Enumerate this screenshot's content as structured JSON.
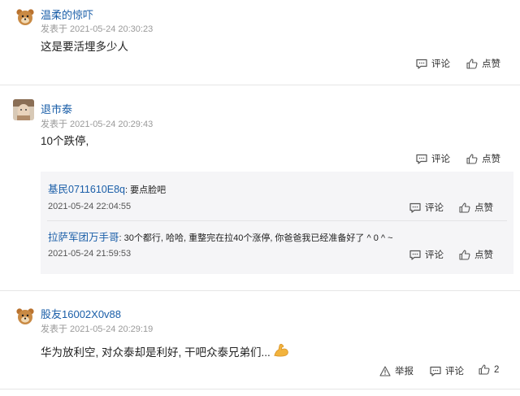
{
  "comments": [
    {
      "user": "温柔的惊吓",
      "meta": "发表于 2021-05-24 20:30:23",
      "text": "这是要活埋多少人",
      "reply_label": "评论",
      "like_label": "点赞"
    },
    {
      "user": "退市泰",
      "meta": "发表于 2021-05-24 20:29:43",
      "text": "10个跌停,",
      "reply_label": "评论",
      "like_label": "点赞",
      "replies": [
        {
          "user": "基民0711610E8q",
          "text": ": 要点脸吧",
          "time": "2021-05-24 22:04:55",
          "reply_label": "评论",
          "like_label": "点赞"
        },
        {
          "user": "拉萨军团万手哥",
          "text": ": 30个都行, 哈哈, 重整完在拉40个涨停, 你爸爸我已经准备好了 ^ 0 ^ ~",
          "time": "2021-05-24 21:59:53",
          "reply_label": "评论",
          "like_label": "点赞"
        }
      ]
    },
    {
      "user": "股友16002X0v88",
      "meta": "发表于 2021-05-24 20:29:19",
      "text": "华为放利空, 对众泰却是利好, 干吧众泰兄弟们...",
      "report_label": "举报",
      "reply_label": "评论",
      "like_count": "2"
    }
  ],
  "icons": {
    "reply": "comment-icon",
    "like": "thumbs-up-icon",
    "report": "warning-icon",
    "emoji": "flexed-biceps-emoji"
  },
  "colors": {
    "username": "#1a5ea8",
    "meta": "#9a9a9a",
    "reply_bg": "#f5f5f7",
    "separator": "#e6e6e6"
  }
}
